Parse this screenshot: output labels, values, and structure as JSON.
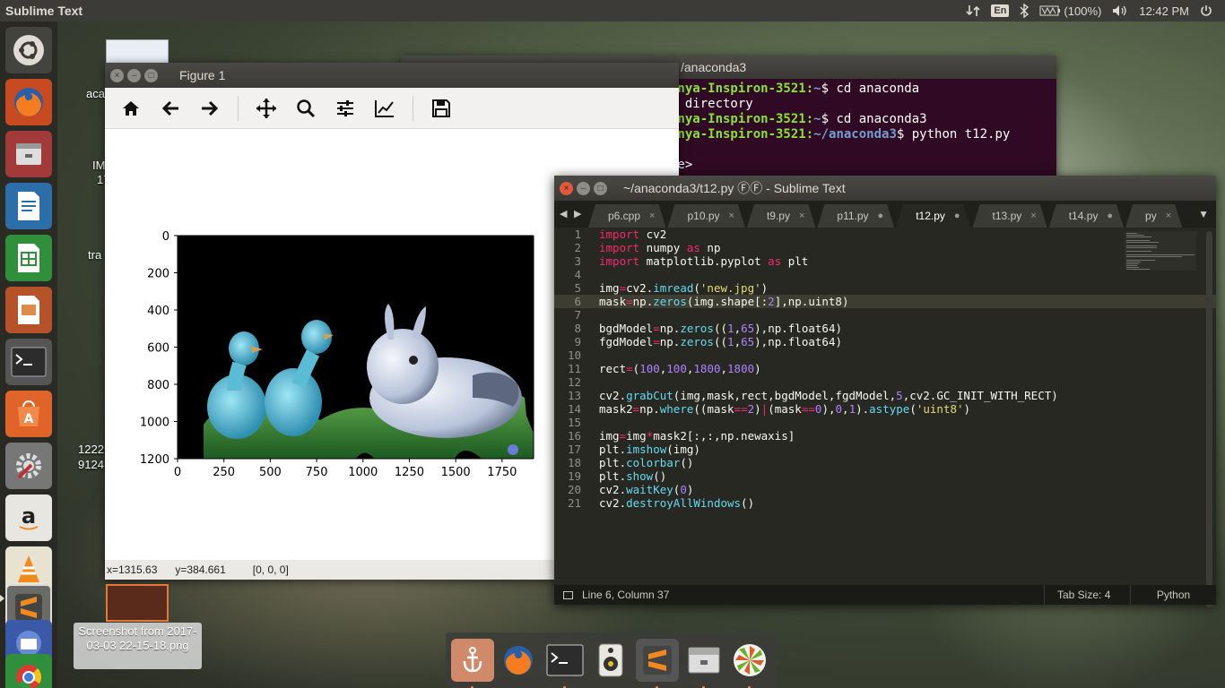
{
  "top_panel": {
    "app_title": "Sublime Text",
    "keyboard": "En",
    "battery": "(100%)",
    "clock": "12:42 PM"
  },
  "desktop": {
    "labels": [
      "aca",
      "IM",
      "17",
      "tra",
      "1222",
      "9124"
    ],
    "screenshot_label": "Screenshot from 2017-03-03 22-15-18.png"
  },
  "figure": {
    "title": "Figure 1",
    "toolbar": [
      "home-icon",
      "back-icon",
      "forward-icon",
      "pan-icon",
      "zoom-icon",
      "configure-icon",
      "edit-axis-icon",
      "save-icon"
    ],
    "status": {
      "x": "x=1315.63",
      "y": "y=384.661",
      "rgb": "[0, 0, 0]"
    }
  },
  "chart_data": {
    "type": "image",
    "x_ticks": [
      "0",
      "250",
      "500",
      "750",
      "1000",
      "1250",
      "1500",
      "1750"
    ],
    "y_ticks": [
      "0",
      "200",
      "400",
      "600",
      "800",
      "1000",
      "1200"
    ],
    "xlim": [
      0,
      1920
    ],
    "ylim": [
      1200,
      0
    ]
  },
  "terminal": {
    "title": "/anaconda3",
    "lines": [
      {
        "prompt": "anya-Inspiron-3521",
        "path": "~",
        "cmd": "$ cd anaconda"
      },
      {
        "plain": "r directory"
      },
      {
        "prompt": "anya-Inspiron-3521",
        "path": "~",
        "cmd": "$ cd anaconda3"
      },
      {
        "prompt": "anya-Inspiron-3521",
        "path": "~/anaconda3",
        "cmd": "$ python t12.py"
      },
      {
        "plain": ""
      },
      {
        "plain": "le>"
      }
    ]
  },
  "sublime": {
    "title": "~/anaconda3/t12.py ⒻⒻ - Sublime Text",
    "tabs": [
      {
        "label": "p6.cpp",
        "mark": "×"
      },
      {
        "label": "p10.py",
        "mark": "×"
      },
      {
        "label": "t9.py",
        "mark": "×"
      },
      {
        "label": "p11.py",
        "mark": "●"
      },
      {
        "label": "t12.py",
        "mark": "●",
        "active": true
      },
      {
        "label": "t13.py",
        "mark": "×"
      },
      {
        "label": "t14.py",
        "mark": "●"
      },
      {
        "label": "py",
        "mark": "×"
      }
    ],
    "status": {
      "position": "Line 6, Column 37",
      "tab_size": "Tab Size: 4",
      "syntax": "Python"
    },
    "current_line": 6
  },
  "code": [
    [
      [
        "kw",
        "import"
      ],
      [
        "t",
        " cv2"
      ]
    ],
    [
      [
        "kw",
        "import"
      ],
      [
        "t",
        " numpy "
      ],
      [
        "kw",
        "as"
      ],
      [
        "t",
        " np"
      ]
    ],
    [
      [
        "kw",
        "import"
      ],
      [
        "t",
        " matplotlib.pyplot "
      ],
      [
        "kw",
        "as"
      ],
      [
        "t",
        " plt"
      ]
    ],
    [],
    [
      [
        "t",
        "img"
      ],
      [
        "kw",
        "="
      ],
      [
        "t",
        "cv2."
      ],
      [
        "fn",
        "imread"
      ],
      [
        "t",
        "("
      ],
      [
        "st",
        "'new.jpg'"
      ],
      [
        "t",
        ")"
      ]
    ],
    [
      [
        "t",
        "mask"
      ],
      [
        "kw",
        "="
      ],
      [
        "t",
        "np."
      ],
      [
        "fn",
        "zeros"
      ],
      [
        "t",
        "(img.shape[:"
      ],
      [
        "nm",
        "2"
      ],
      [
        "t",
        "],np.uint8)"
      ]
    ],
    [],
    [
      [
        "t",
        "bgdModel"
      ],
      [
        "kw",
        "="
      ],
      [
        "t",
        "np."
      ],
      [
        "fn",
        "zeros"
      ],
      [
        "t",
        "(("
      ],
      [
        "nm",
        "1"
      ],
      [
        "t",
        ","
      ],
      [
        "nm",
        "65"
      ],
      [
        "t",
        "),np.float64)"
      ]
    ],
    [
      [
        "t",
        "fgdModel"
      ],
      [
        "kw",
        "="
      ],
      [
        "t",
        "np."
      ],
      [
        "fn",
        "zeros"
      ],
      [
        "t",
        "(("
      ],
      [
        "nm",
        "1"
      ],
      [
        "t",
        ","
      ],
      [
        "nm",
        "65"
      ],
      [
        "t",
        "),np.float64)"
      ]
    ],
    [],
    [
      [
        "t",
        "rect"
      ],
      [
        "kw",
        "="
      ],
      [
        "t",
        "("
      ],
      [
        "nm",
        "100"
      ],
      [
        "t",
        ","
      ],
      [
        "nm",
        "100"
      ],
      [
        "t",
        ","
      ],
      [
        "nm",
        "1800"
      ],
      [
        "t",
        ","
      ],
      [
        "nm",
        "1800"
      ],
      [
        "t",
        ")"
      ]
    ],
    [],
    [
      [
        "t",
        "cv2."
      ],
      [
        "fn",
        "grabCut"
      ],
      [
        "t",
        "(img,mask,rect,bgdModel,fgdModel,"
      ],
      [
        "nm",
        "5"
      ],
      [
        "t",
        ",cv2.GC_INIT_WITH_RECT)"
      ]
    ],
    [
      [
        "t",
        "mask2"
      ],
      [
        "kw",
        "="
      ],
      [
        "t",
        "np."
      ],
      [
        "fn",
        "where"
      ],
      [
        "t",
        "((mask"
      ],
      [
        "kw",
        "=="
      ],
      [
        "nm",
        "2"
      ],
      [
        "t",
        ")"
      ],
      [
        "kw",
        "|"
      ],
      [
        "t",
        "(mask"
      ],
      [
        "kw",
        "=="
      ],
      [
        "nm",
        "0"
      ],
      [
        "t",
        "),"
      ],
      [
        "nm",
        "0"
      ],
      [
        "t",
        ","
      ],
      [
        "nm",
        "1"
      ],
      [
        "t",
        ")."
      ],
      [
        "fn",
        "astype"
      ],
      [
        "t",
        "("
      ],
      [
        "st",
        "'uint8'"
      ],
      [
        "t",
        ")"
      ]
    ],
    [],
    [
      [
        "t",
        "img"
      ],
      [
        "kw",
        "="
      ],
      [
        "t",
        "img"
      ],
      [
        "kw",
        "*"
      ],
      [
        "t",
        "mask2[:,:,np.newaxis]"
      ]
    ],
    [
      [
        "t",
        "plt."
      ],
      [
        "fn",
        "imshow"
      ],
      [
        "t",
        "(img)"
      ]
    ],
    [
      [
        "t",
        "plt."
      ],
      [
        "fn",
        "colorbar"
      ],
      [
        "t",
        "()"
      ]
    ],
    [
      [
        "t",
        "plt."
      ],
      [
        "fn",
        "show"
      ],
      [
        "t",
        "()"
      ]
    ],
    [
      [
        "t",
        "cv2."
      ],
      [
        "fn",
        "waitKey"
      ],
      [
        "t",
        "("
      ],
      [
        "nm",
        "0"
      ],
      [
        "t",
        ")"
      ]
    ],
    [
      [
        "t",
        "cv2."
      ],
      [
        "fn",
        "destroyAllWindows"
      ],
      [
        "t",
        "()"
      ]
    ]
  ]
}
